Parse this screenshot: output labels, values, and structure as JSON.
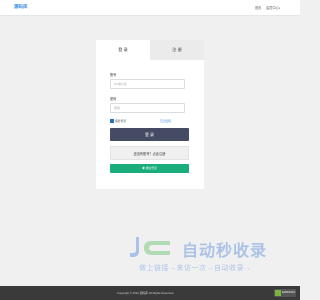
{
  "header": {
    "logo_text": "源码库",
    "nav_home": "首页",
    "nav_user": "会员中心",
    "nav_user_caret": "▾"
  },
  "tabs": [
    {
      "label": "登 录",
      "active": true
    },
    {
      "label": "注 册",
      "active": false
    }
  ],
  "login_form": {
    "account_label": "账号",
    "account_placeholder": "ID/用户名",
    "password_label": "密码",
    "password_placeholder": "密码",
    "remember_label": "保持登录",
    "remember_checked": true,
    "forgot_link": "忘记密码",
    "login_button": "登 录",
    "register_button": "还没有账号？点此注册",
    "wechat_button": "微信登录"
  },
  "watermark": {
    "title": "自动秒收录",
    "subtitle": "做上链接→来访一次→自动收录→"
  },
  "footer": {
    "copyright": "Copyright © 2023 源码库 All Rights Reserved.",
    "badge_text": "EDATASTA"
  },
  "colors": {
    "accent": "#3a8ee6",
    "primary_button": "#444b63",
    "wechat_button": "#1aad7c",
    "footer_bg": "#3a3a3a",
    "page_bg": "#f0f0f0"
  }
}
